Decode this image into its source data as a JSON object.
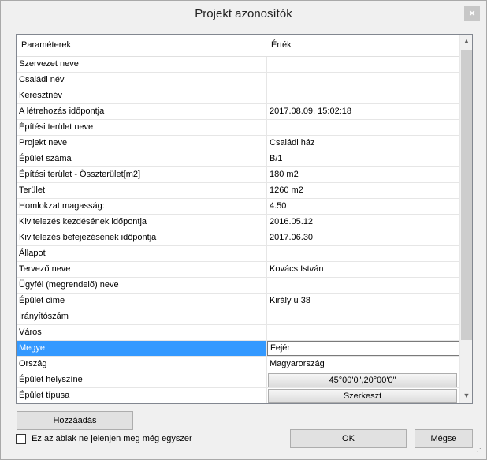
{
  "window": {
    "title": "Projekt azonosítók",
    "close_glyph": "×"
  },
  "grid": {
    "header": {
      "col1": "Paraméterek",
      "col2": "Érték"
    },
    "rows": [
      {
        "name": "Szervezet neve",
        "value": ""
      },
      {
        "name": "Családi név",
        "value": ""
      },
      {
        "name": "Keresztnév",
        "value": ""
      },
      {
        "name": "A létrehozás időpontja",
        "value": "2017.08.09. 15:02:18"
      },
      {
        "name": "Építési terület neve",
        "value": ""
      },
      {
        "name": "Projekt neve",
        "value": "Családi ház"
      },
      {
        "name": "Épület száma",
        "value": "B/1"
      },
      {
        "name": "Építési terület - Összterület[m2]",
        "value": "180 m2"
      },
      {
        "name": "Terület",
        "value": "1260 m2"
      },
      {
        "name": "Homlokzat magasság:",
        "value": "4.50"
      },
      {
        "name": "Kivitelezés kezdésének időpontja",
        "value": "2016.05.12"
      },
      {
        "name": "Kivitelezés befejezésének időpontja",
        "value": "2017.06.30"
      },
      {
        "name": "Állapot",
        "value": ""
      },
      {
        "name": "Tervező neve",
        "value": "Kovács István"
      },
      {
        "name": "Ügyfél (megrendelő) neve",
        "value": ""
      },
      {
        "name": "Épület címe",
        "value": "Király u 38"
      },
      {
        "name": "Irányítószám",
        "value": ""
      },
      {
        "name": "Város",
        "value": ""
      },
      {
        "name": "Megye",
        "value": "Fejér",
        "selected": true
      },
      {
        "name": "Ország",
        "value": "Magyarország"
      },
      {
        "name": "Épület helyszíne",
        "value": "45°00'0\",20°00'0\"",
        "button": true
      },
      {
        "name": "Épület típusa",
        "value": "Szerkeszt",
        "button": true
      }
    ],
    "scroll_up_glyph": "▲",
    "scroll_down_glyph": "▼"
  },
  "footer": {
    "add_label": "Hozzáadás",
    "checkbox_label": "Ez az ablak ne jelenjen meg még egyszer",
    "checkbox_checked": false,
    "ok_label": "OK",
    "cancel_label": "Mégse"
  },
  "colors": {
    "selection": "#3399ff",
    "background": "#f0f0f0"
  }
}
